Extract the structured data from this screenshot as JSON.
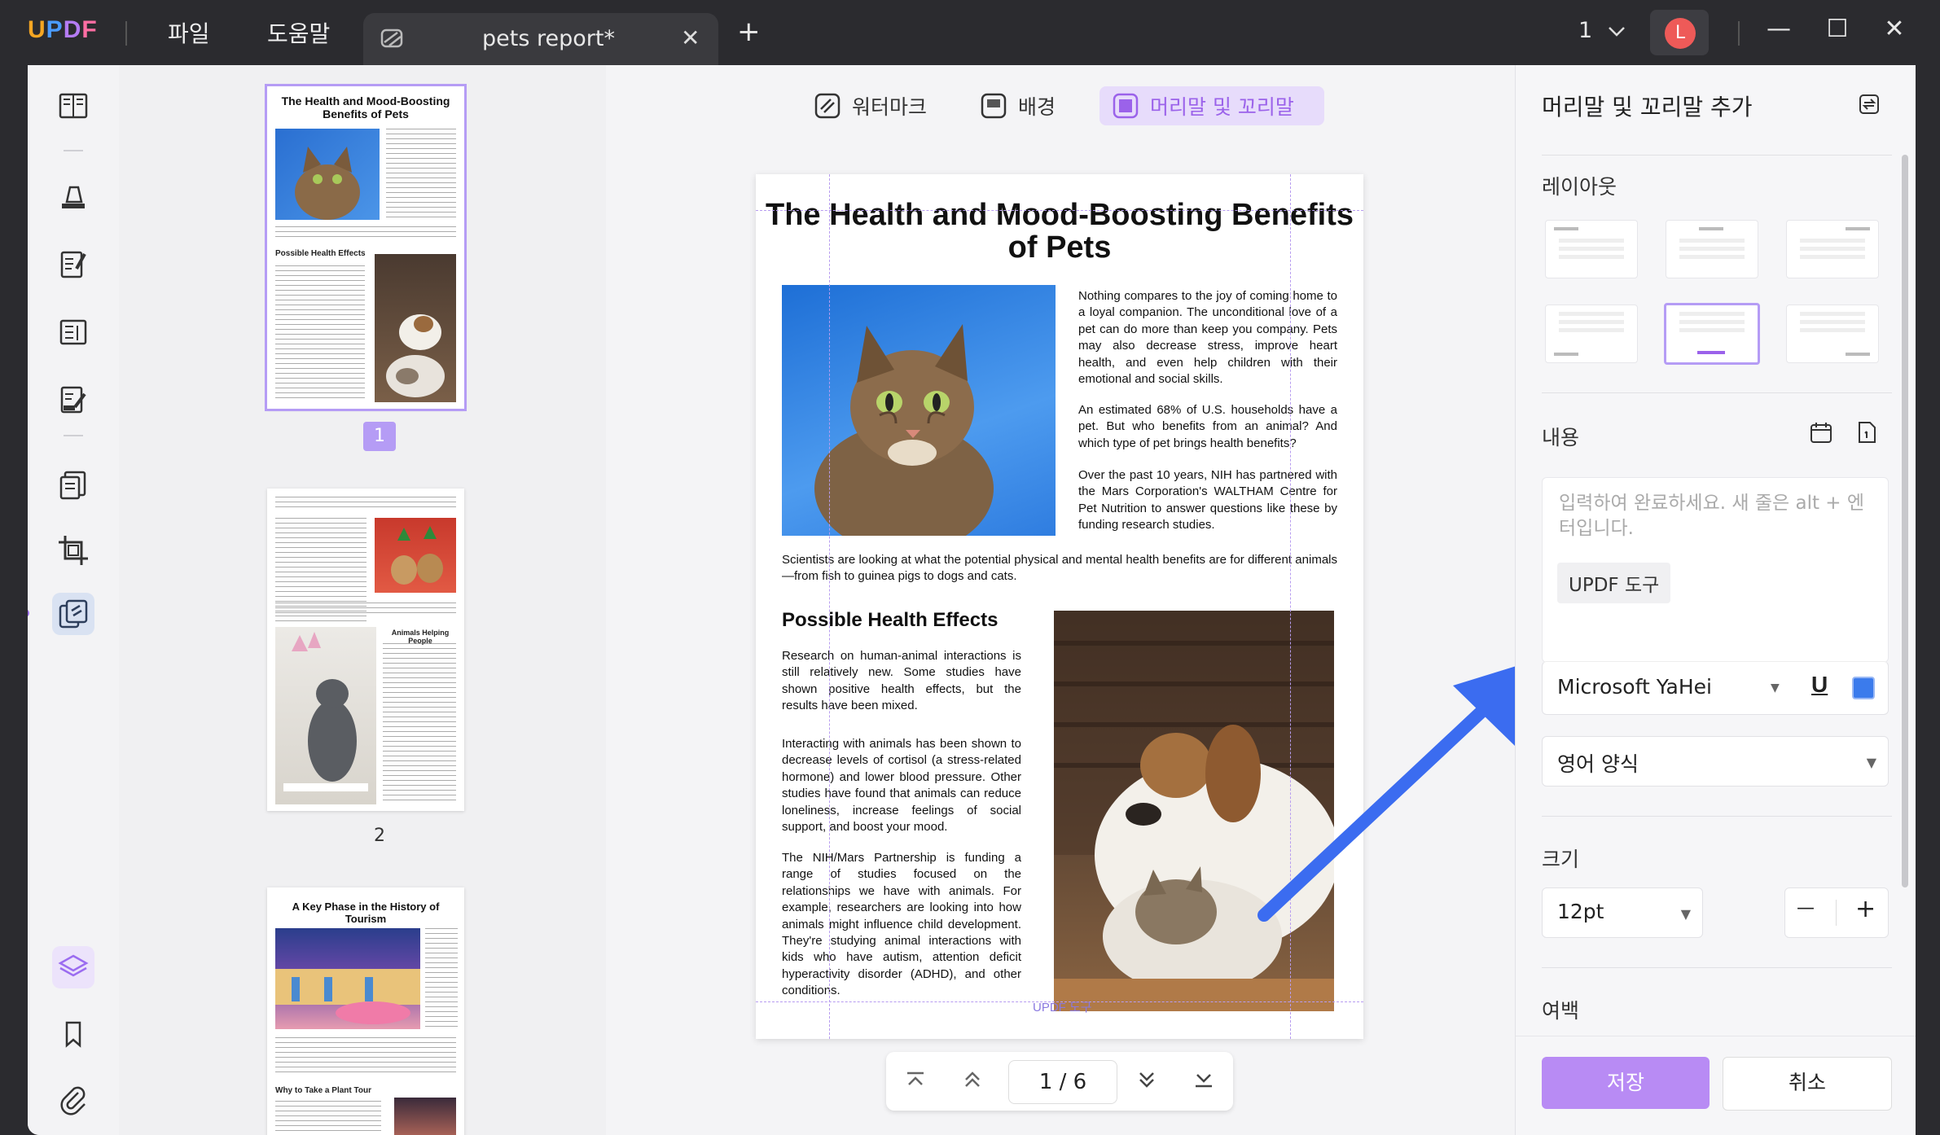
{
  "app": {
    "logo": "UPDF",
    "menu": [
      "파일",
      "도움말"
    ],
    "tab_title": "pets report*",
    "tab_close": "✕",
    "new_tab": "+",
    "page_count": "1",
    "user_initial": "L",
    "window_buttons": {
      "minimize": "—",
      "maximize": "☐",
      "close": "✕"
    }
  },
  "thumbnails": {
    "page1_title": "The Health and Mood-Boosting Benefits of Pets",
    "page1_heading": "Possible Health Effects",
    "page1_number": "1",
    "page2_heading": "Animals Helping People",
    "page2_number": "2",
    "page3_title": "A Key Phase in the History of Tourism",
    "page3_heading": "Why to Take a Plant Tour"
  },
  "view_tabs": [
    "워터마크",
    "배경",
    "머리말 및 꼬리말"
  ],
  "page": {
    "title": "The Health and Mood-Boosting Benefits of Pets",
    "para1": "Nothing compares to the joy of coming home to a loyal companion. The unconditional love of a pet can do more than keep you company. Pets may also decrease stress, improve heart health, and even help children with their emotional and social skills.",
    "para2": "An estimated 68% of U.S. households have a pet. But who benefits from an animal? And which type of pet brings health benefits?",
    "para3": "Over the past 10 years, NIH has partnered with the Mars Corporation's WALTHAM Centre for Pet Nutrition to answer questions like these by funding research studies.",
    "para4": "Scientists are looking at what the potential physical and mental health benefits are for different animals—from fish to guinea pigs to dogs and cats.",
    "heading": "Possible Health Effects",
    "para5": "Research on human-animal interactions is still relatively new. Some studies have shown positive health effects, but the results have been mixed.",
    "para6": "Interacting with animals has been shown to decrease levels of cortisol (a stress-related hormone) and lower blood pressure. Other studies have found that animals can reduce loneliness, increase feelings of social support, and boost your mood.",
    "para7": "The NIH/Mars Partnership is funding a range of studies focused on the relationships we have with animals. For example, researchers are looking into how animals might influence child development. They're studying animal interactions with kids who have autism, attention deficit hyperactivity disorder (ADHD), and other conditions.",
    "footer_preview": "UPDF 도구"
  },
  "pagenav": {
    "first": "⌅",
    "prev": "︽",
    "current": "1 / 6",
    "next": "︾",
    "last": "⌄"
  },
  "panel": {
    "title": "머리말 및 꼬리말 추가",
    "layout_label": "레이아웃",
    "content_label": "내용",
    "placeholder": "입력하여 완료하세요. 새 줄은 alt + 엔터입니다.",
    "chip": "UPDF 도구",
    "font": "Microsoft YaHei",
    "underline": "U",
    "number_style": "영어 양식",
    "size_label": "크기",
    "size": "12pt",
    "minus": "—",
    "plus": "+",
    "margin_label": "여백",
    "save": "저장",
    "cancel": "취소"
  },
  "colors": {
    "accent": "#b88bf4",
    "arrow": "#3b6cf0",
    "active_tab_bg": "#e7dcfb"
  }
}
